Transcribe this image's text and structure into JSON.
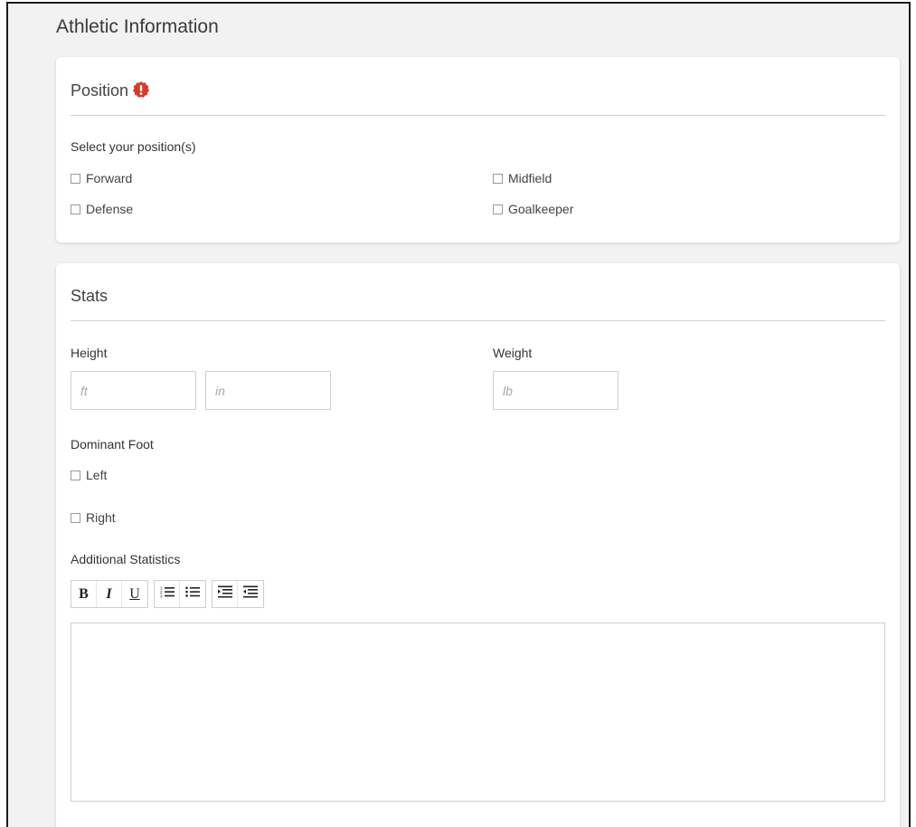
{
  "section": {
    "title": "Athletic Information"
  },
  "position_card": {
    "heading": "Position",
    "alert_icon": "exclamation-badge-icon",
    "alert_color": "#d63b2a",
    "prompt": "Select your position(s)",
    "options": [
      "Forward",
      "Midfield",
      "Defense",
      "Goalkeeper"
    ]
  },
  "stats_card": {
    "heading": "Stats",
    "height_label": "Height",
    "height_ft_placeholder": "ft",
    "height_in_placeholder": "in",
    "weight_label": "Weight",
    "weight_placeholder": "lb",
    "foot_label": "Dominant Foot",
    "foot_options": [
      "Left",
      "Right"
    ],
    "additional_label": "Additional Statistics",
    "toolbar": {
      "bold": "B",
      "italic": "I",
      "underline": "U",
      "ordered_list_icon": "ordered-list-icon",
      "bullet_list_icon": "bullet-list-icon",
      "indent_icon": "indent-icon",
      "outdent_icon": "outdent-icon"
    }
  }
}
